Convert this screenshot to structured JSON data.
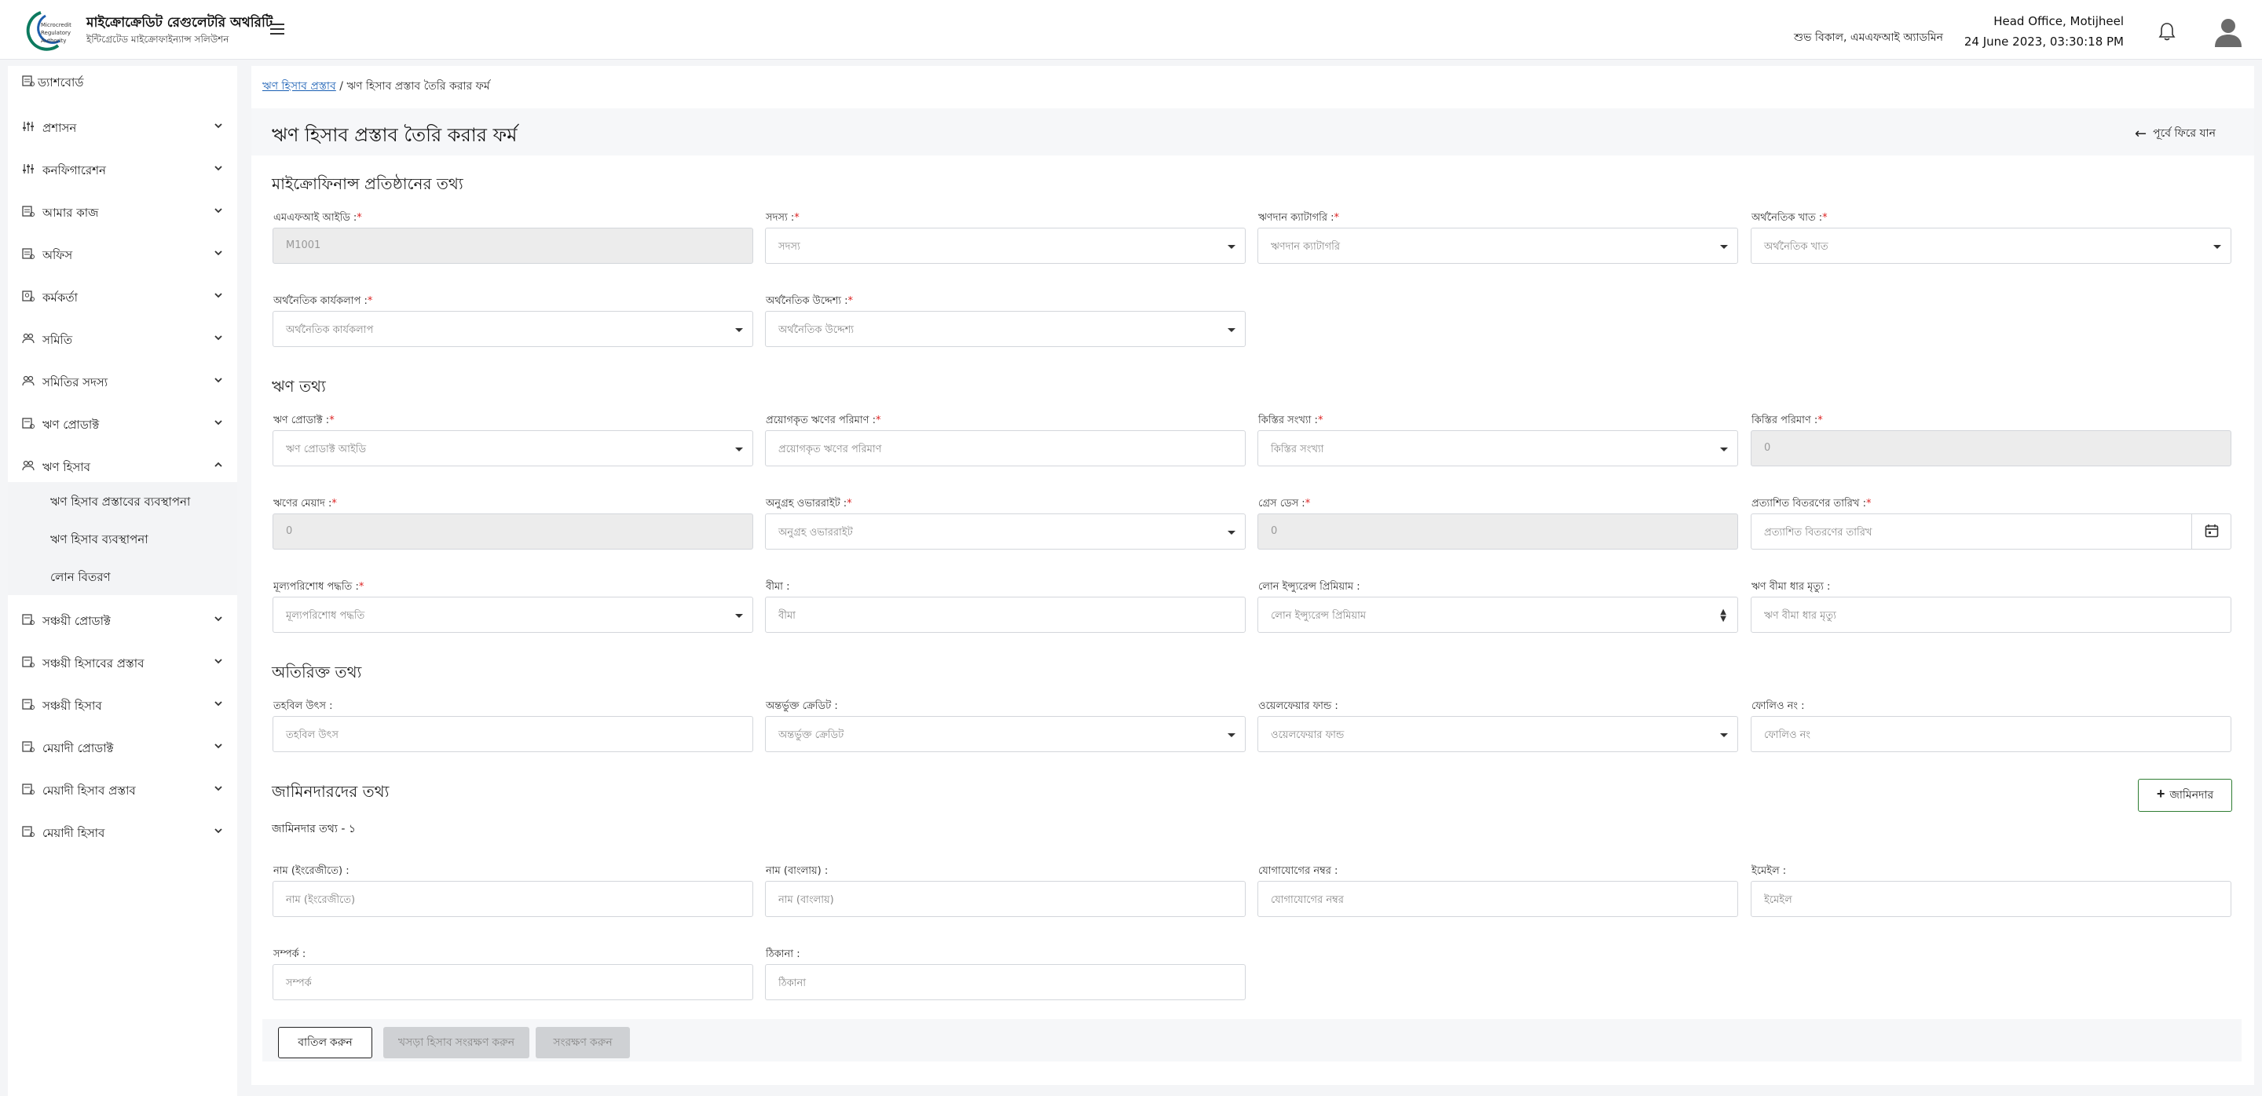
{
  "header": {
    "brand_title": "মাইক্রোক্রেডিট রেগুলেটরি অথরিটি",
    "brand_subtitle": "ইন্টিগ্রেটেড মাইক্রোফাইন্যান্স সলিউশন",
    "logo_text": [
      "Microcredit",
      "Regulatory",
      "Authority"
    ],
    "greeting": "শুভ বিকাল, এমএফআই অ্যাডমিন",
    "office": "Head Office, Motijheel",
    "datetime": "24 June 2023, 03:30:18 PM"
  },
  "sidebar": {
    "dashboard": "ড্যাশবোর্ড",
    "items": [
      {
        "label": "প্রশাসন",
        "icon": "sliders-icon"
      },
      {
        "label": "কনফিগারেশন",
        "icon": "sliders-icon"
      },
      {
        "label": "আমার কাজ",
        "icon": "task-icon"
      },
      {
        "label": "অফিস",
        "icon": "office-icon"
      },
      {
        "label": "কর্মকর্তা",
        "icon": "staff-icon"
      },
      {
        "label": "সমিতি",
        "icon": "group-icon"
      },
      {
        "label": "সমিতির সদস্য",
        "icon": "members-icon"
      },
      {
        "label": "ঋণ প্রোডাক্ট",
        "icon": "loan-product-icon"
      },
      {
        "label": "ঋণ হিসাব",
        "icon": "loan-account-icon"
      },
      {
        "label": "সঞ্চয়ী প্রোডাক্ট",
        "icon": "savings-product-icon"
      },
      {
        "label": "সঞ্চয়ী হিসাবের প্রস্তাব",
        "icon": "savings-proposal-icon"
      },
      {
        "label": "সঞ্চয়ী হিসাব",
        "icon": "savings-account-icon"
      },
      {
        "label": "মেয়াদী প্রোডাক্ট",
        "icon": "term-product-icon"
      },
      {
        "label": "মেয়াদী হিসাব প্রস্তাব",
        "icon": "term-proposal-icon"
      },
      {
        "label": "মেয়াদী হিসাব",
        "icon": "term-account-icon"
      }
    ],
    "sub_items": [
      "ঋণ হিসাব প্রস্তাবের ব্যবস্থাপনা",
      "ঋণ হিসাব ব্যবস্থাপনা",
      "লোন বিতরণ"
    ]
  },
  "breadcrumb": {
    "link": "ঋণ হিসাব প্রস্তাব",
    "separator": "/",
    "current": "ঋণ হিসাব প্রস্তাব তৈরি করার ফর্ম"
  },
  "page": {
    "title": "ঋণ হিসাব প্রস্তাব তৈরি করার ফর্ম",
    "back_label": "পূর্বে ফিরে যান"
  },
  "sections": {
    "mfi": "মাইক্রোফিনান্স প্রতিষ্ঠানের তথ্য",
    "loan": "ঋণ তথ্য",
    "extra": "অতিরিক্ত তথ্য",
    "guarantor": "জামিনদারদের তথ্য",
    "guarantor_sub": "জামিনদার তথ্য - ১"
  },
  "fields": {
    "mfi_id": {
      "label": "এমএফআই আইডি :",
      "value": "M1001"
    },
    "member": {
      "label": "সদস্য :",
      "placeholder": "সদস্য"
    },
    "loan_category": {
      "label": "ঋণদান ক্যাটাগরি :",
      "placeholder": "ঋণদান ক্যাটাগরি"
    },
    "economic_sector": {
      "label": "অর্থনৈতিক খাত :",
      "placeholder": "অর্থনৈতিক খাত"
    },
    "economic_activity": {
      "label": "অর্থনৈতিক কার্যকলাপ :",
      "placeholder": "অর্থনৈতিক কার্যকলাপ"
    },
    "economic_purpose": {
      "label": "অর্থনৈতিক উদ্দেশ্য :",
      "placeholder": "অর্থনৈতিক উদ্দেশ্য"
    },
    "loan_product": {
      "label": "ঋণ প্রোডাক্ট :",
      "placeholder": "ঋণ প্রোডাক্ট আইডি"
    },
    "applied_amount": {
      "label": "প্রয়োগকৃত ঋণের পরিমাণ :",
      "placeholder": "প্রয়োগকৃত ঋণের পরিমাণ"
    },
    "installment_count": {
      "label": "কিস্তির সংখ্যা :",
      "placeholder": "কিস্তির সংখ্যা"
    },
    "installment_amount": {
      "label": "কিস্তির পরিমাণ :",
      "value": "0"
    },
    "loan_term": {
      "label": "ঋণের মেয়াদ :",
      "value": "0"
    },
    "grace_override": {
      "label": "অনুগ্রহ ওভাররাইট :",
      "placeholder": "অনুগ্রহ ওভাররাইট"
    },
    "grace_days": {
      "label": "গ্রেস ডেস :",
      "value": "0"
    },
    "expected_disbursement_date": {
      "label": "প্রত্যাশিত বিতরণের তারিখ :",
      "placeholder": "প্রত্যাশিত বিতরণের তারিখ"
    },
    "repayment_method": {
      "label": "মূল্যপরিশোধ পদ্ধতি :",
      "placeholder": "মূল্যপরিশোধ পদ্ধতি"
    },
    "insurance": {
      "label": "বীমা :",
      "placeholder": "বীমা"
    },
    "loan_insurance_premium": {
      "label": "লোন ইন্স্যুরেন্স প্রিমিয়াম :",
      "placeholder": "লোন ইন্স্যুরেন্স প্রিমিয়াম"
    },
    "loan_insurance_death": {
      "label": "ঋণ বীমা ধার মৃত্যু :",
      "placeholder": "ঋণ বীমা ধার মৃত্যু"
    },
    "fund_source": {
      "label": "তহবিল উৎস :",
      "placeholder": "তহবিল উৎস"
    },
    "included_credit": {
      "label": "অন্তর্ভুক্ত ক্রেডিট :",
      "placeholder": "অন্তর্ভুক্ত ক্রেডিট"
    },
    "welfare_fund": {
      "label": "ওয়েলফেয়ার ফান্ড :",
      "placeholder": "ওয়েলফেয়ার ফান্ড"
    },
    "folio_no": {
      "label": "ফোলিও নং :",
      "placeholder": "ফোলিও নং"
    },
    "name_en": {
      "label": "নাম (ইংরেজীতে) :",
      "placeholder": "নাম (ইংরেজীতে)"
    },
    "name_bn": {
      "label": "নাম (বাংলায়) :",
      "placeholder": "নাম (বাংলায়)"
    },
    "phone": {
      "label": "যোগাযোগের নম্বর :",
      "placeholder": "যোগাযোগের নম্বর"
    },
    "email": {
      "label": "ইমেইল :",
      "placeholder": "ইমেইল"
    },
    "relation": {
      "label": "সম্পর্ক :",
      "placeholder": "সম্পর্ক"
    },
    "address": {
      "label": "ঠিকানা :",
      "placeholder": "ঠিকানা"
    }
  },
  "required_mark": "*",
  "buttons": {
    "add_guarantor": "জামিনদার",
    "cancel": "বাতিল করুন",
    "save_draft": "খসড়া হিসাব সংরক্ষণ করুন",
    "save": "সংরক্ষণ করুন"
  }
}
